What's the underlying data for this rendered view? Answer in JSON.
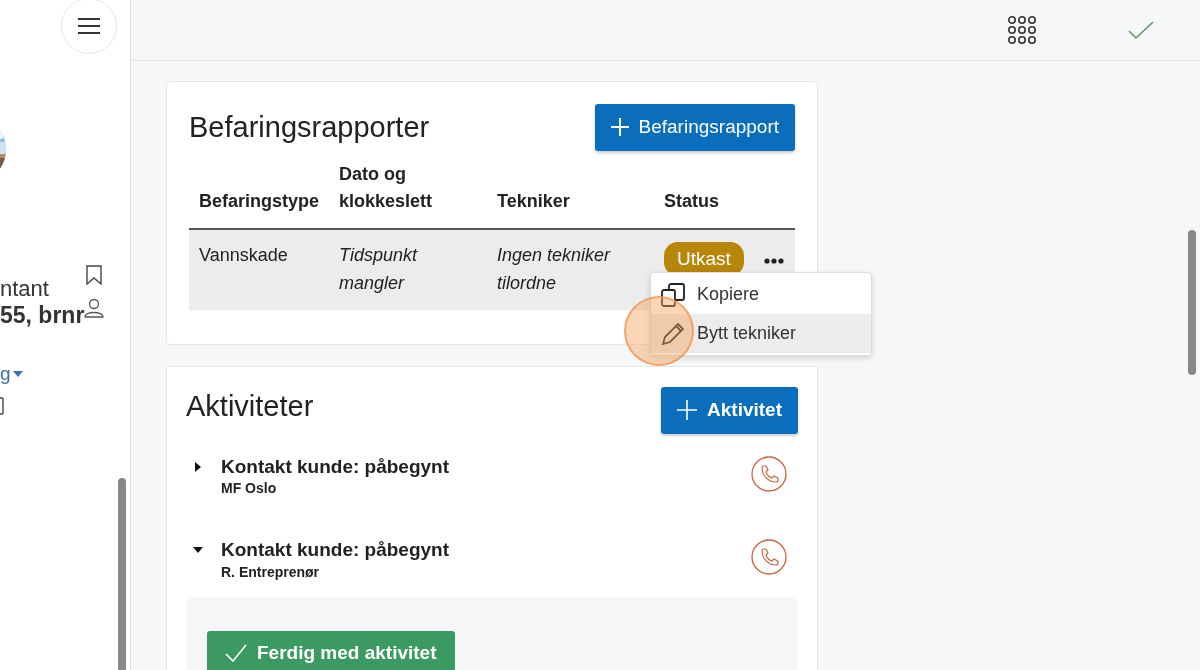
{
  "sidebar": {
    "subtitle": "ntant",
    "title": "55, brnr",
    "link": "g"
  },
  "reports": {
    "title": "Befaringsrapporter",
    "add_button": "Befaringsrapport",
    "columns": [
      "Befaringstype",
      "Dato og klokkeslett",
      "Tekniker",
      "Status"
    ],
    "rows": [
      {
        "type": "Vannskade",
        "datetime": "Tidspunkt mangler",
        "technician": "Ingen tekniker tilordne",
        "status": "Utkast",
        "menu_open": true
      }
    ],
    "menu": [
      {
        "label": "Kopiere",
        "kind": "copy",
        "selected": false
      },
      {
        "label": "Bytt tekniker",
        "kind": "edit",
        "selected": true
      }
    ]
  },
  "activities": {
    "title": "Aktiviteter",
    "add_button": "Aktivitet",
    "items": [
      {
        "title": "Kontakt kunde: påbegynt",
        "subtitle": "MF Oslo",
        "expanded": false
      },
      {
        "title": "Kontakt kunde: påbegynt",
        "subtitle": "R. Entreprenør",
        "expanded": true,
        "done_button": "Ferdig med aktivitet"
      }
    ]
  }
}
